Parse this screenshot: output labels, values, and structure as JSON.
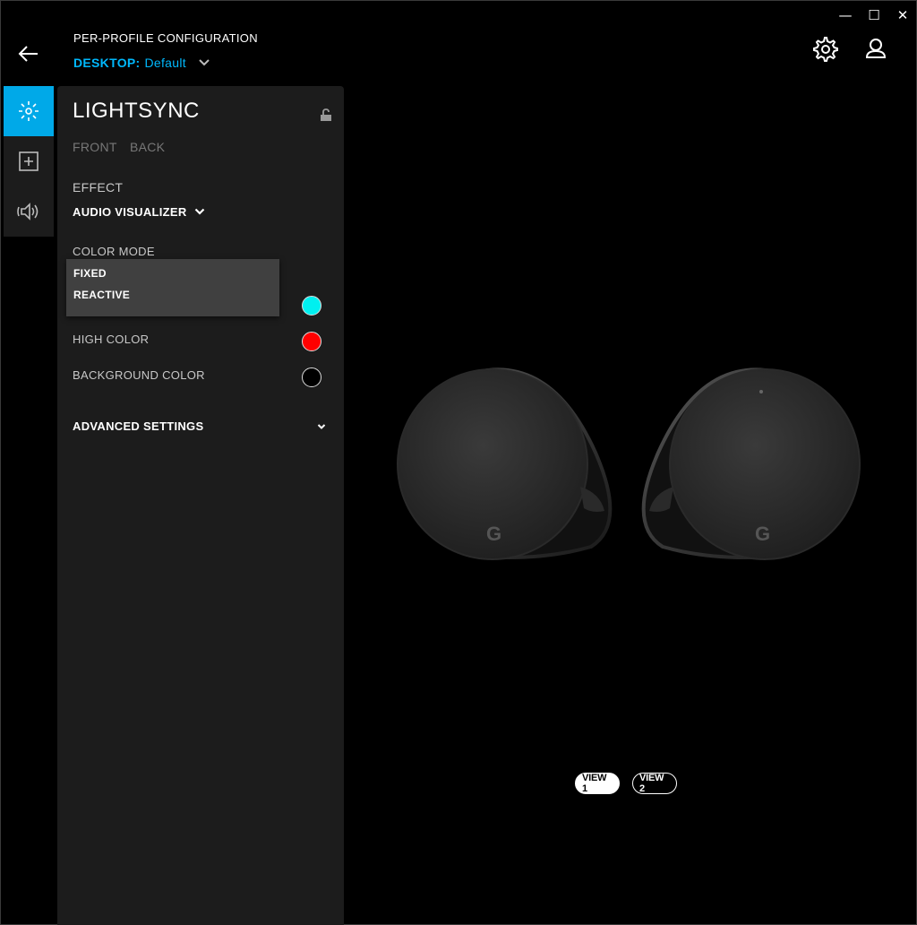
{
  "window": {
    "minimize_glyph": "—",
    "maximize_glyph": "☐",
    "close_glyph": "✕"
  },
  "header": {
    "title": "PER-PROFILE CONFIGURATION",
    "profile_key": "DESKTOP:",
    "profile_value": "Default",
    "accent_color": "#00b8fc"
  },
  "rail": {
    "items": [
      {
        "icon": "lightsync-icon",
        "active": true
      },
      {
        "icon": "assignments-icon",
        "active": false
      },
      {
        "icon": "speaker-icon",
        "active": false
      }
    ]
  },
  "panel": {
    "title": "LIGHTSYNC",
    "tabs": [
      {
        "label": "FRONT"
      },
      {
        "label": "BACK"
      }
    ],
    "effect_label": "EFFECT",
    "effect_value": "AUDIO VISUALIZER",
    "color_mode_label": "COLOR MODE",
    "color_mode_options": [
      "FIXED",
      "REACTIVE"
    ],
    "colors": [
      {
        "label": "",
        "color": "#00f0f0"
      },
      {
        "label": "HIGH COLOR",
        "color": "#ff0000"
      },
      {
        "label": "BACKGROUND COLOR",
        "color": "#000000"
      }
    ],
    "advanced_label": "ADVANCED SETTINGS"
  },
  "views": {
    "view1": "VIEW 1",
    "view2": "VIEW 2"
  }
}
